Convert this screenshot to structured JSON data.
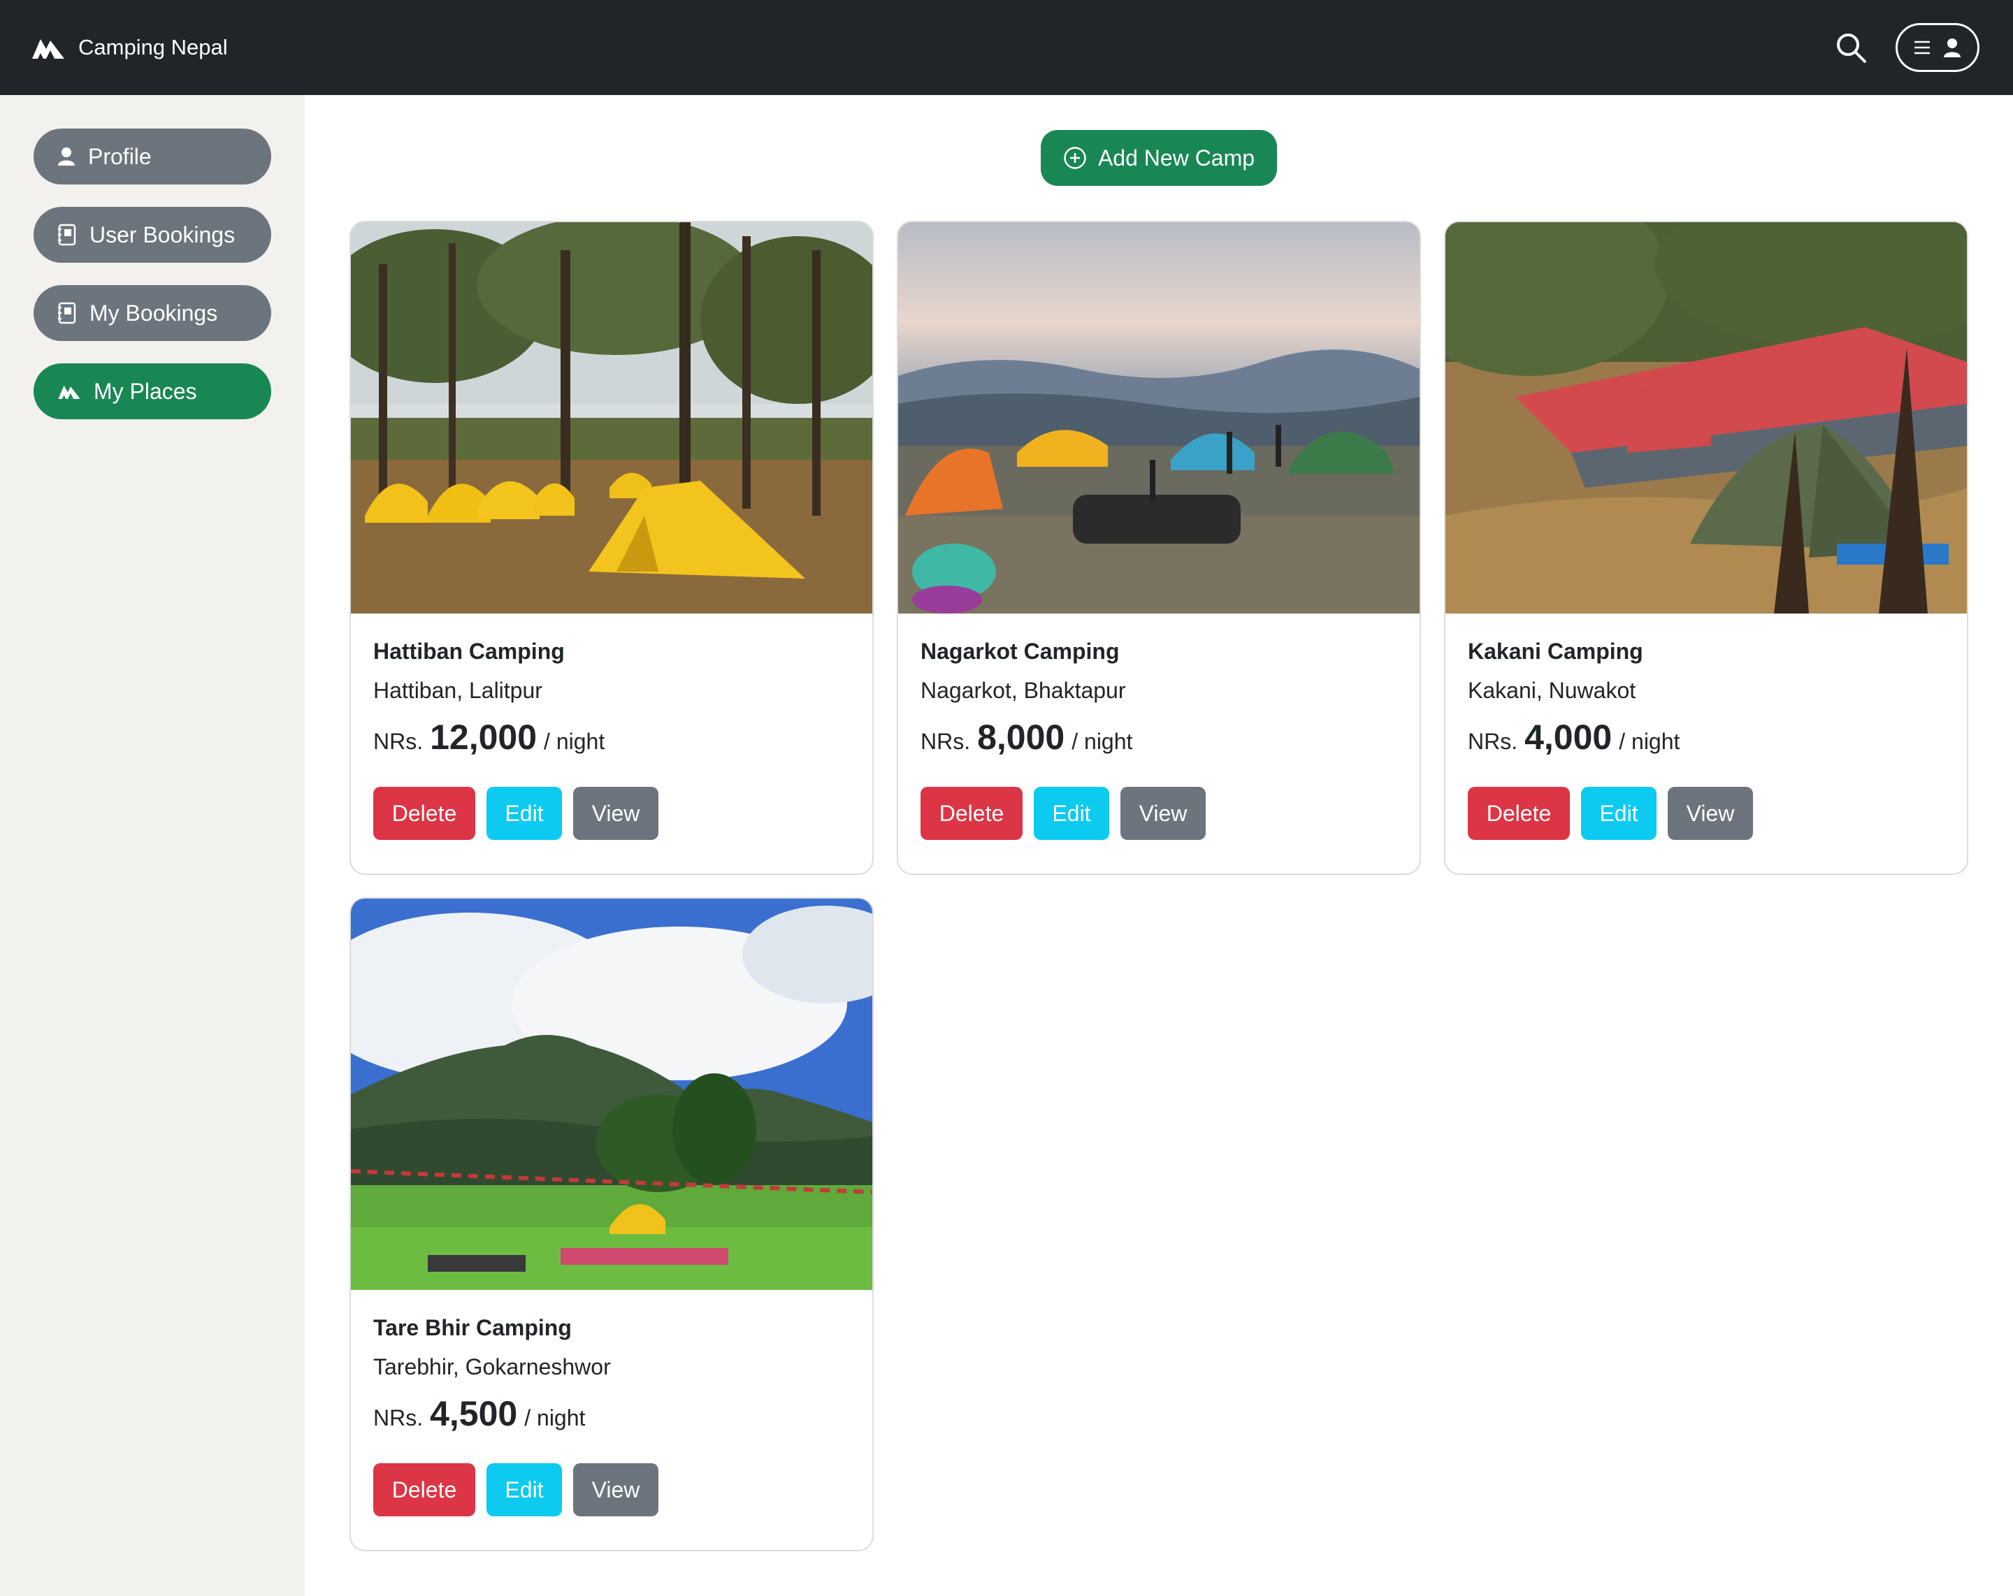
{
  "app": {
    "brand_name": "Camping Nepal",
    "brand_icon": "tent-icon"
  },
  "header": {
    "search_icon": "search-icon",
    "menu_icon": "menu-icon",
    "user_icon": "user-icon"
  },
  "sidebar": {
    "items": [
      {
        "label": "Profile",
        "icon": "user-icon",
        "active": false
      },
      {
        "label": "User Bookings",
        "icon": "notebook-icon",
        "active": false
      },
      {
        "label": "My Bookings",
        "icon": "notebook-icon",
        "active": false
      },
      {
        "label": "My Places",
        "icon": "tent-icon",
        "active": true
      }
    ]
  },
  "main": {
    "add_button_label": "Add New Camp",
    "add_button_icon": "plus-circle-icon",
    "cards": [
      {
        "title": "Hattiban Camping",
        "location": "Hattiban, Lalitpur",
        "currency": "NRs.",
        "price": "12,000",
        "unit": "/ night",
        "delete_label": "Delete",
        "edit_label": "Edit",
        "view_label": "View"
      },
      {
        "title": "Nagarkot Camping",
        "location": "Nagarkot, Bhaktapur",
        "currency": "NRs.",
        "price": "8,000",
        "unit": "/ night",
        "delete_label": "Delete",
        "edit_label": "Edit",
        "view_label": "View"
      },
      {
        "title": "Kakani Camping",
        "location": "Kakani, Nuwakot",
        "currency": "NRs.",
        "price": "4,000",
        "unit": "/ night",
        "delete_label": "Delete",
        "edit_label": "Edit",
        "view_label": "View"
      },
      {
        "title": "Tare Bhir Camping",
        "location": "Tarebhir, Gokarneshwor",
        "currency": "NRs.",
        "price": "4,500",
        "unit": "/ night",
        "delete_label": "Delete",
        "edit_label": "Edit",
        "view_label": "View"
      }
    ]
  },
  "colors": {
    "navbar": "#212529",
    "sidebar_bg": "#f2f1ed",
    "primary_green": "#198754",
    "secondary_gray": "#6c757d",
    "danger": "#dc3545",
    "info": "#0dcaf0"
  }
}
